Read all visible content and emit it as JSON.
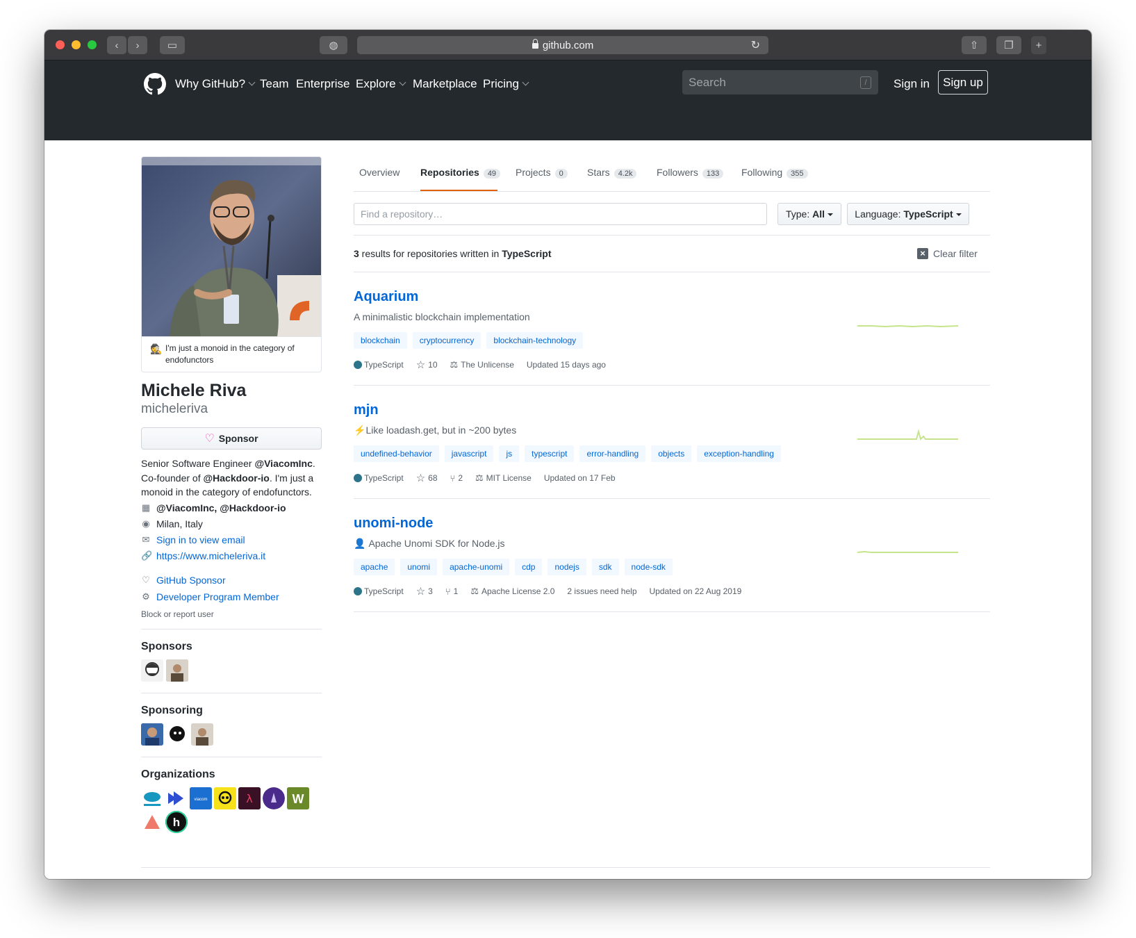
{
  "browser": {
    "url": "github.com"
  },
  "header": {
    "nav": [
      {
        "label": "Why GitHub?",
        "caret": true
      },
      {
        "label": "Team",
        "caret": false
      },
      {
        "label": "Enterprise",
        "caret": false
      },
      {
        "label": "Explore",
        "caret": true
      },
      {
        "label": "Marketplace",
        "caret": false
      },
      {
        "label": "Pricing",
        "caret": true
      }
    ],
    "search_placeholder": "Search",
    "search_shortcut": "/",
    "signin": "Sign in",
    "signup": "Sign up"
  },
  "profile": {
    "status": "I'm just a monoid in the category of endofunctors",
    "status_emoji": "🕵",
    "name": "Michele Riva",
    "username": "micheleriva",
    "sponsor_label": "Sponsor",
    "bio_1": "Senior Software Engineer ",
    "bio_company": "@ViacomInc",
    "bio_2": ". Co-founder of ",
    "bio_company2": "@Hackdoor-io",
    "bio_3": ". I'm just a monoid in the category of endofunctors.",
    "company": "@ViacomInc, @Hackdoor-io",
    "location": "Milan, Italy",
    "email": "Sign in to view email",
    "website": "https://www.micheleriva.it",
    "badge_sponsor": "GitHub Sponsor",
    "badge_dev": "Developer Program Member",
    "block": "Block or report user",
    "sponsors_title": "Sponsors",
    "sponsoring_title": "Sponsoring",
    "orgs_title": "Organizations"
  },
  "tabs": [
    {
      "label": "Overview",
      "count": ""
    },
    {
      "label": "Repositories",
      "count": "49"
    },
    {
      "label": "Projects",
      "count": "0"
    },
    {
      "label": "Stars",
      "count": "4.2k"
    },
    {
      "label": "Followers",
      "count": "133"
    },
    {
      "label": "Following",
      "count": "355"
    }
  ],
  "filter": {
    "placeholder": "Find a repository…",
    "type_label": "Type: ",
    "type_value": "All",
    "lang_label": "Language: ",
    "lang_value": "TypeScript",
    "results_count": "3",
    "results_text": " results for repositories written in ",
    "results_lang": "TypeScript",
    "clear": "Clear filter"
  },
  "repos": [
    {
      "name": "Aquarium",
      "desc": "A minimalistic blockchain implementation",
      "emoji": "",
      "topics": [
        "blockchain",
        "cryptocurrency",
        "blockchain-technology"
      ],
      "language": "TypeScript",
      "stars": "10",
      "forks": "",
      "license": "The Unlicense",
      "issues": "",
      "updated": "Updated 15 days ago"
    },
    {
      "name": "mjn",
      "desc": "Like loadash.get, but in ~200 bytes",
      "emoji": "⚡",
      "topics": [
        "undefined-behavior",
        "javascript",
        "js",
        "typescript",
        "error-handling",
        "objects",
        "exception-handling"
      ],
      "language": "TypeScript",
      "stars": "68",
      "forks": "2",
      "license": "MIT License",
      "issues": "",
      "updated": "Updated on 17 Feb"
    },
    {
      "name": "unomi-node",
      "desc": "Apache Unomi SDK for Node.js",
      "emoji": "👤",
      "topics": [
        "apache",
        "unomi",
        "apache-unomi",
        "cdp",
        "nodejs",
        "sdk",
        "node-sdk"
      ],
      "language": "TypeScript",
      "stars": "3",
      "forks": "1",
      "license": "Apache License 2.0",
      "issues": "2 issues need help",
      "updated": "Updated on 22 Aug 2019"
    }
  ],
  "colors": {
    "accent": "#0366d6",
    "tab_underline": "#e36209",
    "typescript": "#2b7489",
    "header": "#24292e"
  }
}
